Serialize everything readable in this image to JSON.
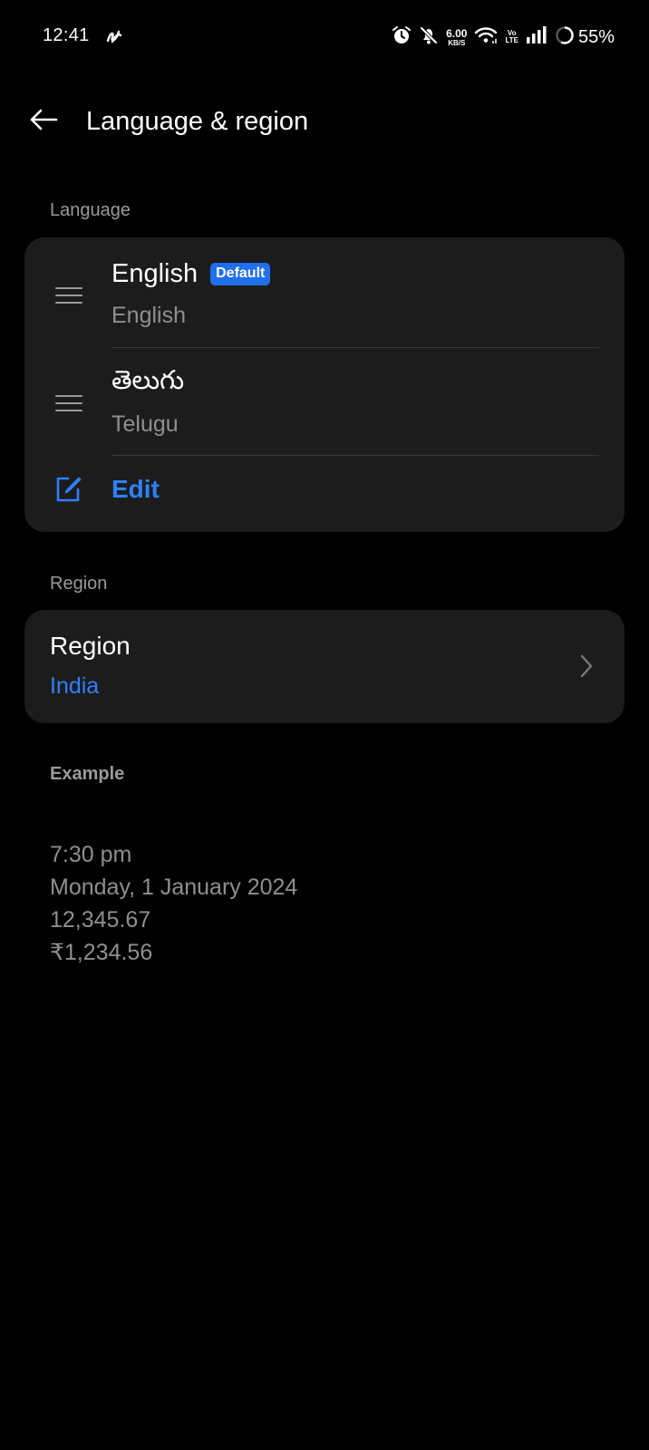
{
  "status_bar": {
    "time": "12:41",
    "app_icon": "assistant-swirl-icon",
    "net_speed_value": "6.00",
    "net_speed_unit": "KB/S",
    "volte_top": "Vo",
    "volte_bottom": "LTE",
    "battery_percent": "55%",
    "icons": [
      "alarm-icon",
      "mute-bell-icon",
      "wifi-icon",
      "signal-icon",
      "battery-ring-icon"
    ]
  },
  "header": {
    "title": "Language & region",
    "back_icon": "back-arrow-icon"
  },
  "language_section": {
    "label": "Language",
    "languages": [
      {
        "name": "English",
        "native_name": "English",
        "badge": "Default"
      },
      {
        "name": "తెలుగు",
        "native_name": "Telugu",
        "badge": ""
      }
    ],
    "edit_label": "Edit"
  },
  "region_section": {
    "label": "Region",
    "title": "Region",
    "value": "India"
  },
  "example_section": {
    "label": "Example",
    "lines": [
      "7:30 pm",
      "Monday, 1 January 2024",
      "12,345.67",
      "₹1,234.56"
    ]
  },
  "colors": {
    "background": "#000000",
    "card": "#1c1c1c",
    "accent": "#2f80ff",
    "badge": "#1f6fee",
    "secondary_text": "#8f8f8f"
  }
}
